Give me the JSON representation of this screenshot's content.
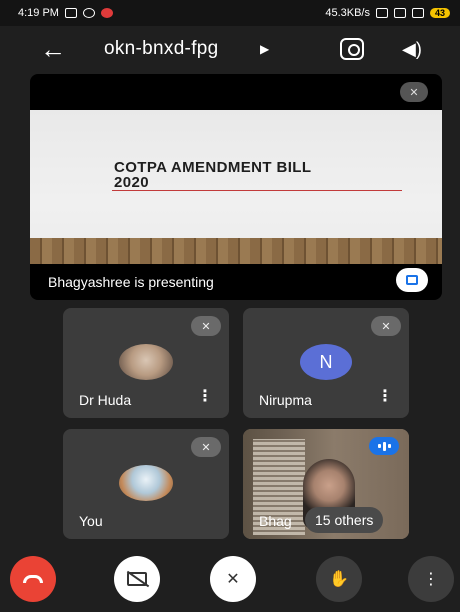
{
  "status_bar": {
    "time": "4:19 PM",
    "speed": "45.3KB/s",
    "battery": "43"
  },
  "header": {
    "meeting_code": "okn-bnxd-fpg"
  },
  "presentation": {
    "slide_title_line1": "COTPA AMENDMENT BILL",
    "slide_title_line2": "2020",
    "presenter_label": "Bhagyashree is presenting"
  },
  "participants": [
    {
      "name": "Dr Huda",
      "avatar": "photo",
      "muted": true
    },
    {
      "name": "Nirupma",
      "avatar_letter": "N",
      "muted": true
    },
    {
      "name": "You",
      "avatar": "photo",
      "muted": true
    },
    {
      "name_partial": "Bhag",
      "speaking": true
    }
  ],
  "others_chip": "15 others",
  "icons": {
    "back": "arrow-left-icon",
    "flip_camera": "flip-camera-icon",
    "speaker": "speaker-icon",
    "mic_off": "mic-off-icon",
    "fullscreen": "fullscreen-icon",
    "end_call": "end-call-icon",
    "camera_off": "camera-off-icon",
    "raise_hand": "raise-hand-icon",
    "more": "more-vert-icon"
  },
  "colors": {
    "end_call": "#ea4335",
    "accent": "#1a73e8",
    "avatar_n": "#5b6fd6"
  }
}
